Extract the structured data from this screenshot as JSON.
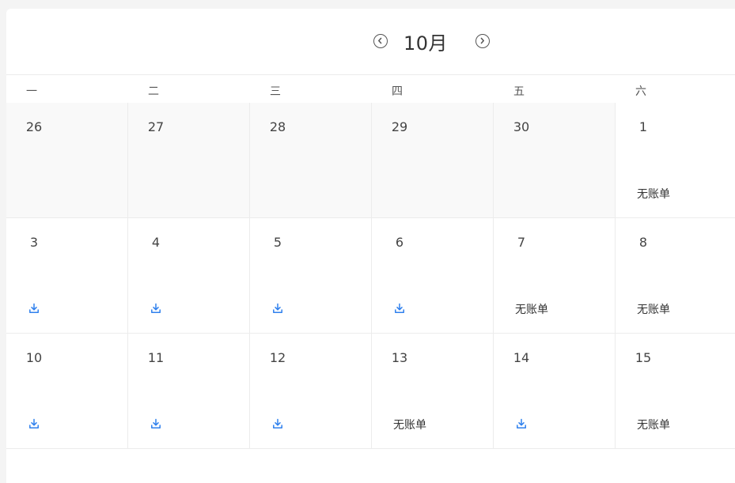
{
  "header": {
    "month_label": "10月",
    "prev_icon": "chevron-left-circle-icon",
    "next_icon": "chevron-right-circle-icon"
  },
  "weekdays": [
    "一",
    "二",
    "三",
    "四",
    "五",
    "六"
  ],
  "no_bill_label": "无账单",
  "download_icon": "download-icon",
  "accent_color": "#2f80ed",
  "weeks": [
    [
      {
        "day": "26",
        "other": true,
        "status": "none"
      },
      {
        "day": "27",
        "other": true,
        "status": "none"
      },
      {
        "day": "28",
        "other": true,
        "status": "none"
      },
      {
        "day": "29",
        "other": true,
        "status": "none"
      },
      {
        "day": "30",
        "other": true,
        "status": "none"
      },
      {
        "day": "1",
        "other": false,
        "status": "no_bill"
      }
    ],
    [
      {
        "day": "3",
        "other": false,
        "status": "download"
      },
      {
        "day": "4",
        "other": false,
        "status": "download"
      },
      {
        "day": "5",
        "other": false,
        "status": "download"
      },
      {
        "day": "6",
        "other": false,
        "status": "download"
      },
      {
        "day": "7",
        "other": false,
        "status": "no_bill"
      },
      {
        "day": "8",
        "other": false,
        "status": "no_bill"
      }
    ],
    [
      {
        "day": "10",
        "other": false,
        "status": "download"
      },
      {
        "day": "11",
        "other": false,
        "status": "download"
      },
      {
        "day": "12",
        "other": false,
        "status": "download"
      },
      {
        "day": "13",
        "other": false,
        "status": "no_bill"
      },
      {
        "day": "14",
        "other": false,
        "status": "download"
      },
      {
        "day": "15",
        "other": false,
        "status": "no_bill"
      }
    ]
  ]
}
